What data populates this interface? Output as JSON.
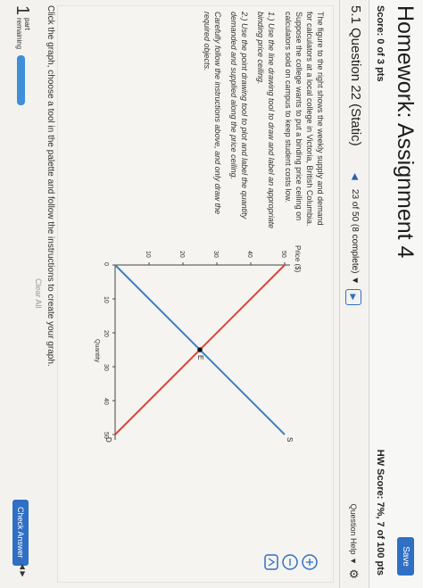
{
  "header": {
    "title": "Homework: Assignment 4",
    "save_label": "Save",
    "score": "Score: 0 of 3 pts",
    "hw_score": "HW Score: 7%, 7 of 100 pts"
  },
  "question": {
    "title": "5.1 Question 22 (Static)",
    "nav_label": "23 of 50 (8 complete)",
    "help_label": "Question Help"
  },
  "prompt": {
    "p1": "The figure to the right shows the weekly supply and demand for calculators at a local college in Victoria, British Columbia. Suppose the college wants to put a binding price ceiling on calculators sold on campus to keep student costs low.",
    "p2": "1.) Use the line drawing tool to draw and label an appropriate binding price ceiling.",
    "p3": "2.) Use the point drawing tool to plot and label the quantity demanded and supplied along the price ceiling.",
    "p4": "Carefully follow the instructions above, and only draw the required objects."
  },
  "chart_data": {
    "type": "line",
    "ylabel": "Price ($)",
    "xlabel": "Quantity",
    "xlim": [
      0,
      50
    ],
    "ylim": [
      0,
      50
    ],
    "x_ticks": [
      "0",
      "10",
      "20",
      "30",
      "40",
      "50"
    ],
    "y_ticks": [
      "10",
      "20",
      "30",
      "40",
      "50"
    ],
    "series": [
      {
        "name": "S",
        "color": "#3a7fc6",
        "points": [
          [
            0,
            0
          ],
          [
            50,
            50
          ]
        ]
      },
      {
        "name": "D",
        "color": "#d9463a",
        "points": [
          [
            0,
            50
          ],
          [
            50,
            0
          ]
        ]
      }
    ],
    "equilibrium": {
      "label": "E",
      "x": 25,
      "y": 25
    }
  },
  "tools": {
    "zoom_in_icon": "zoom-in-icon",
    "zoom_out_icon": "zoom-out-icon",
    "share_icon": "share-icon"
  },
  "instructions": "Click the graph, choose a tool in the palette and follow the instructions to create your graph.",
  "clear_all": "Clear All",
  "footer": {
    "part_number": "1",
    "part_text": "part",
    "remaining_text": "remaining",
    "progress": 0.2,
    "check_answer": "Check Answer"
  }
}
